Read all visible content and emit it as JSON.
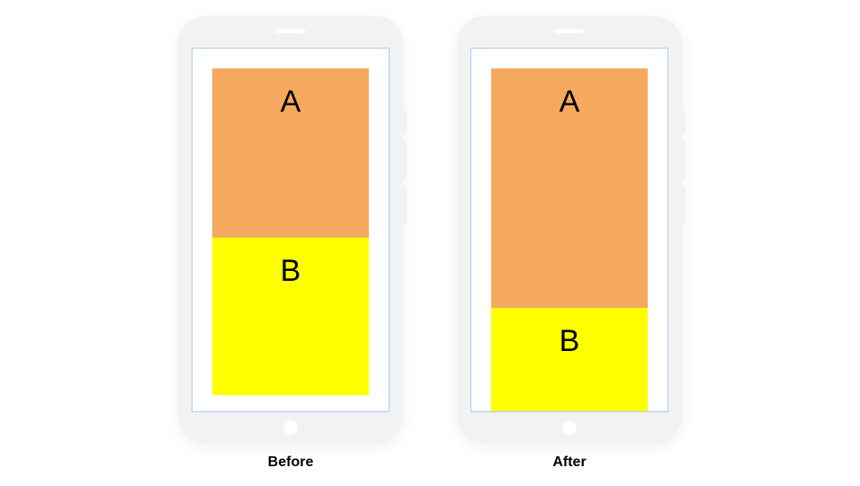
{
  "phones": {
    "before": {
      "caption": "Before",
      "boxA": {
        "label": "A",
        "color": "#f5a95f"
      },
      "boxB": {
        "label": "B",
        "color": "#ffff00"
      }
    },
    "after": {
      "caption": "After",
      "boxA": {
        "label": "A",
        "color": "#f5a95f"
      },
      "boxB": {
        "label": "B",
        "color": "#ffff00"
      }
    }
  }
}
